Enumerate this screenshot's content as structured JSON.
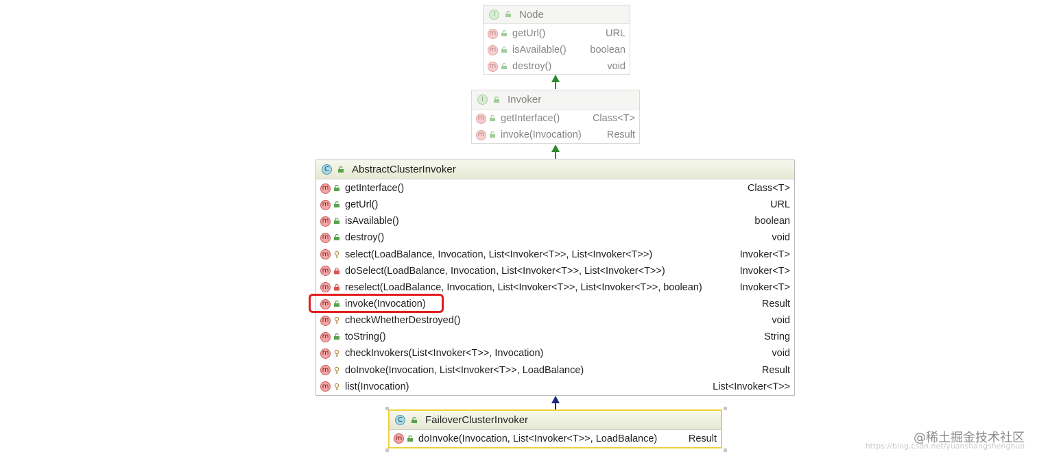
{
  "colors": {
    "arrow_green": "#2a8a2a",
    "arrow_navy": "#1e2a80",
    "highlight_red": "#e21c1c",
    "selected_border": "#f0d23a"
  },
  "node": {
    "title": "Node",
    "title_icon": "interface-icon",
    "methods": [
      {
        "sig": "getUrl()",
        "ret": "URL",
        "vis": "public"
      },
      {
        "sig": "isAvailable()",
        "ret": "boolean",
        "vis": "public"
      },
      {
        "sig": "destroy()",
        "ret": "void",
        "vis": "public"
      }
    ]
  },
  "invoker": {
    "title": "Invoker",
    "title_icon": "interface-icon",
    "methods": [
      {
        "sig": "getInterface()",
        "ret": "Class<T>",
        "vis": "public"
      },
      {
        "sig": "invoke(Invocation)",
        "ret": "Result",
        "vis": "public"
      }
    ]
  },
  "abstract_cluster_invoker": {
    "title": "AbstractClusterInvoker",
    "title_icon": "abstract-class-icon",
    "methods": [
      {
        "sig": "getInterface()",
        "ret": "Class<T>",
        "vis": "public"
      },
      {
        "sig": "getUrl()",
        "ret": "URL",
        "vis": "public"
      },
      {
        "sig": "isAvailable()",
        "ret": "boolean",
        "vis": "public"
      },
      {
        "sig": "destroy()",
        "ret": "void",
        "vis": "public"
      },
      {
        "sig": "select(LoadBalance, Invocation, List<Invoker<T>>, List<Invoker<T>>)",
        "ret": "Invoker<T>",
        "vis": "protected"
      },
      {
        "sig": "doSelect(LoadBalance, Invocation, List<Invoker<T>>, List<Invoker<T>>)",
        "ret": "Invoker<T>",
        "vis": "private"
      },
      {
        "sig": "reselect(LoadBalance, Invocation, List<Invoker<T>>, List<Invoker<T>>, boolean)",
        "ret": "Invoker<T>",
        "vis": "private"
      },
      {
        "sig": "invoke(Invocation)",
        "ret": "Result",
        "vis": "public",
        "highlighted": true
      },
      {
        "sig": "checkWhetherDestroyed()",
        "ret": "void",
        "vis": "protected"
      },
      {
        "sig": "toString()",
        "ret": "String",
        "vis": "public"
      },
      {
        "sig": "checkInvokers(List<Invoker<T>>, Invocation)",
        "ret": "void",
        "vis": "protected"
      },
      {
        "sig": "doInvoke(Invocation, List<Invoker<T>>, LoadBalance)",
        "ret": "Result",
        "vis": "protected"
      },
      {
        "sig": "list(Invocation)",
        "ret": "List<Invoker<T>>",
        "vis": "protected"
      }
    ]
  },
  "failover_cluster_invoker": {
    "title": "FailoverClusterInvoker",
    "title_icon": "class-icon",
    "methods": [
      {
        "sig": "doInvoke(Invocation, List<Invoker<T>>, LoadBalance)",
        "ret": "Result",
        "vis": "public"
      }
    ]
  },
  "watermark": {
    "main": "@稀土掘金技术社区",
    "url": "https://blog.csdn.net/yuanshangshenghuo"
  }
}
